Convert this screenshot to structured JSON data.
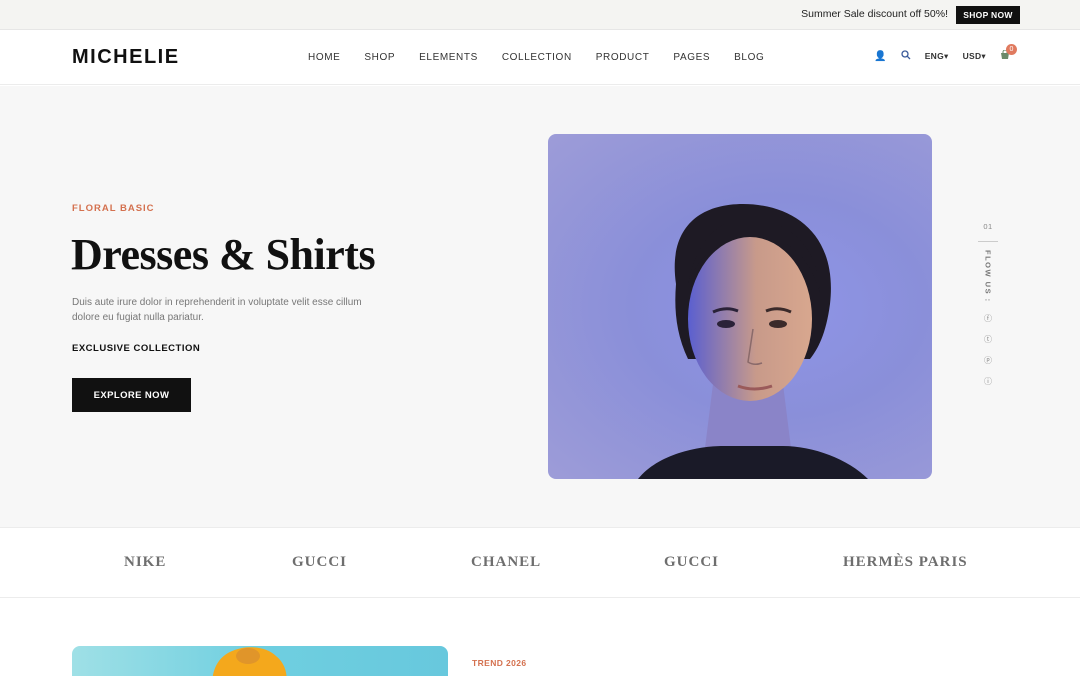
{
  "topbar": {
    "promo": "Summer Sale discount off 50%!",
    "shop_now": "SHOP NOW"
  },
  "header": {
    "logo": "MICHELIE",
    "nav": [
      "HOME",
      "SHOP",
      "ELEMENTS",
      "COLLECTION",
      "PRODUCT",
      "PAGES",
      "BLOG"
    ],
    "language": "ENG▾",
    "currency": "USD▾",
    "cart_count": "0",
    "icons": [
      "user-icon",
      "search-icon",
      "cart-icon"
    ]
  },
  "hero": {
    "eyebrow": "FLORAL BASIC",
    "title": "Dresses & Shirts",
    "description": "Duis aute irure dolor in reprehenderit in voluptate velit esse cillum dolore eu fugiat nulla pariatur.",
    "collection": "EXCLUSIVE COLLECTION",
    "cta": "EXPLORE NOW",
    "slide_number": "01",
    "follow_label": "FLOW US :",
    "social": [
      "facebook-icon",
      "twitter-icon",
      "pinterest-icon",
      "instagram-icon"
    ]
  },
  "brands": [
    "NIKE",
    "GUCCI",
    "CHANEL",
    "GUCCI",
    "HERMÈS PARIS"
  ],
  "trend": {
    "eyebrow": "TREND 2026"
  },
  "colors": {
    "accent": "#d4714f",
    "dark": "#111111",
    "hero_bg": "#f7f7f7"
  }
}
